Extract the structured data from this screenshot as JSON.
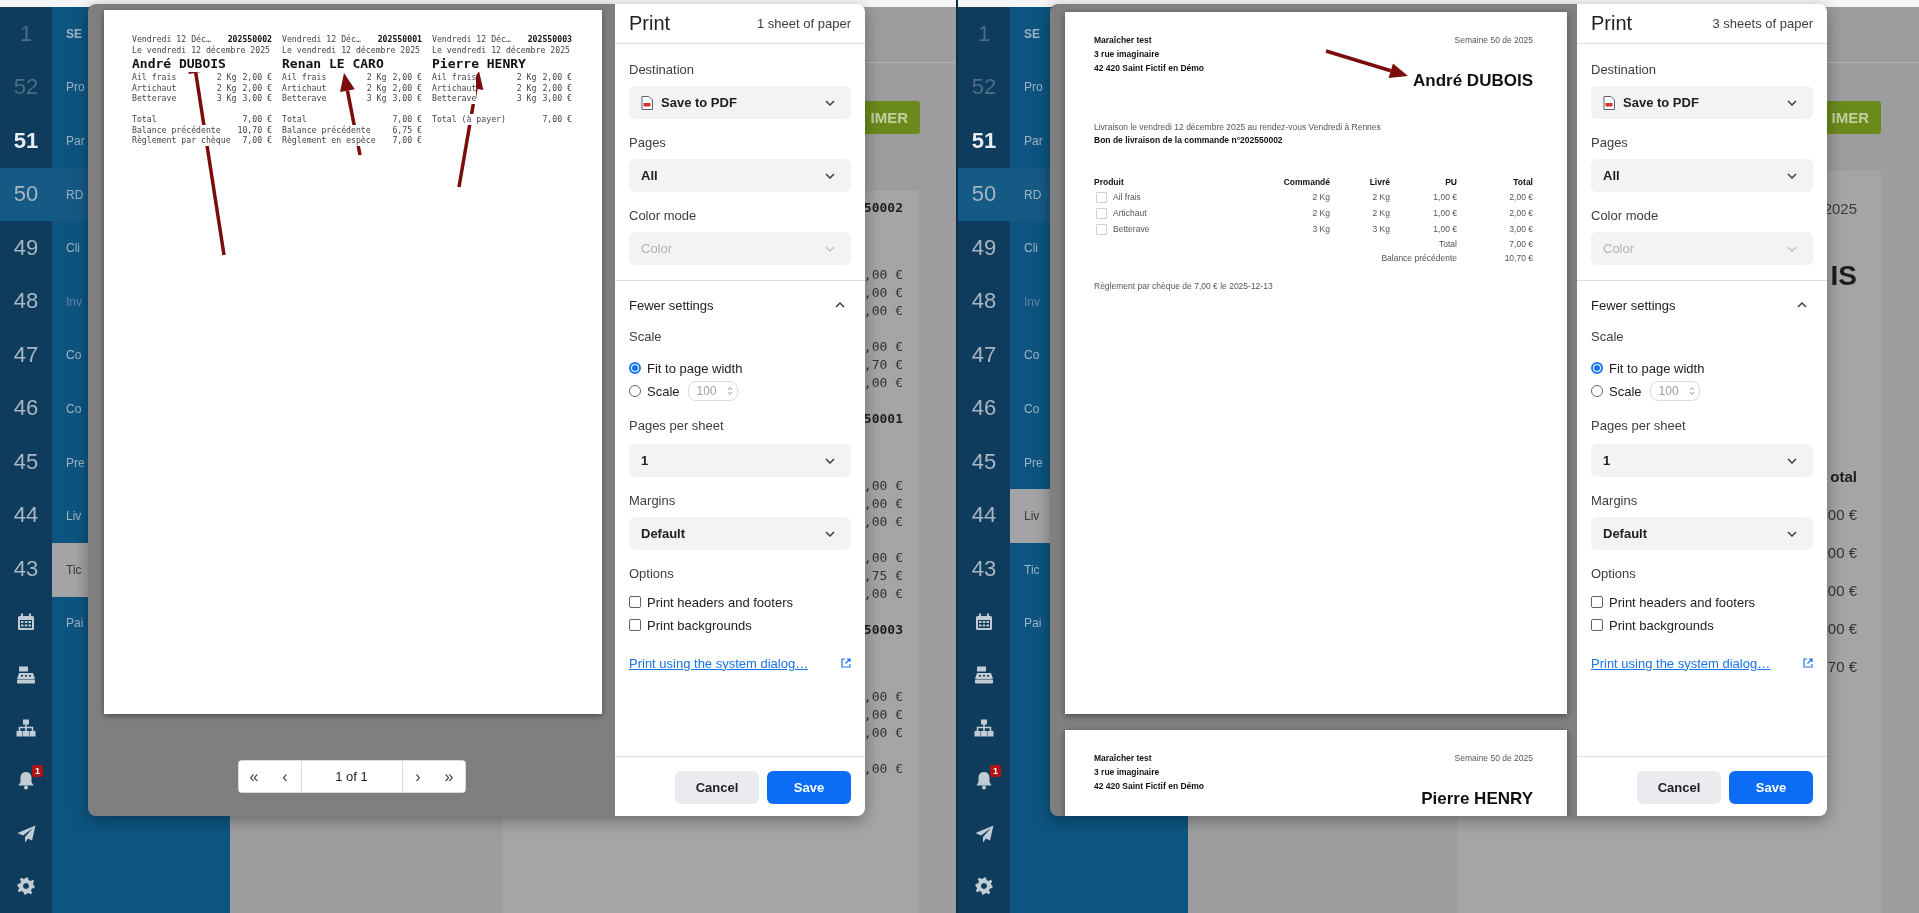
{
  "panels": [
    {
      "weeks": [
        {
          "label": "1",
          "muted": true,
          "selected": false,
          "current": false
        },
        {
          "label": "52",
          "muted": true,
          "selected": false,
          "current": false
        },
        {
          "label": "51",
          "muted": false,
          "selected": true,
          "current": false
        },
        {
          "label": "50",
          "muted": false,
          "selected": false,
          "current": true
        },
        {
          "label": "49",
          "muted": false,
          "selected": false,
          "current": false
        },
        {
          "label": "48",
          "muted": false,
          "selected": false,
          "current": false
        },
        {
          "label": "47",
          "muted": false,
          "selected": false,
          "current": false
        },
        {
          "label": "46",
          "muted": false,
          "selected": false,
          "current": false
        },
        {
          "label": "45",
          "muted": false,
          "selected": false,
          "current": false
        },
        {
          "label": "44",
          "muted": false,
          "selected": false,
          "current": false
        },
        {
          "label": "43",
          "muted": false,
          "selected": false,
          "current": false
        }
      ],
      "notifications": "1",
      "nav": [
        {
          "label": "SE",
          "kind": "header",
          "selected": false,
          "disabled": false
        },
        {
          "label": "Pro",
          "kind": "item",
          "selected": false,
          "disabled": false
        },
        {
          "label": "Par",
          "kind": "item",
          "selected": false,
          "disabled": false
        },
        {
          "label": "RD",
          "kind": "item",
          "selected": false,
          "disabled": false
        },
        {
          "label": "Cli",
          "kind": "item",
          "selected": false,
          "disabled": false
        },
        {
          "label": "Inv",
          "kind": "item",
          "selected": false,
          "disabled": true
        },
        {
          "label": "Co",
          "kind": "item",
          "selected": false,
          "disabled": false
        },
        {
          "label": "Co",
          "kind": "item",
          "selected": false,
          "disabled": false
        },
        {
          "label": "Pre",
          "kind": "item",
          "selected": false,
          "disabled": false
        },
        {
          "label": "Liv",
          "kind": "item",
          "selected": false,
          "disabled": false
        },
        {
          "label": "Tic",
          "kind": "item",
          "selected": true,
          "disabled": false
        },
        {
          "label": "Pai",
          "kind": "item",
          "selected": false,
          "disabled": false
        }
      ],
      "background": {
        "kind": "tickets",
        "button": "IMER",
        "orders": [
          {
            "ref": "50002",
            "items": [
              ",00 €",
              ",00 €",
              ",00 €"
            ],
            "totals": [
              ",00 €",
              ",70 €",
              ",00 €"
            ]
          },
          {
            "ref": "50001",
            "items": [
              ",00 €",
              ",00 €",
              ",00 €"
            ],
            "totals": [
              ",00 €",
              ",75 €",
              ",00 €"
            ]
          },
          {
            "ref": "50003",
            "items": [
              ",00 €",
              ",00 €",
              ",00 €"
            ],
            "totals": [
              ",00 €"
            ]
          }
        ]
      },
      "preview": {
        "kind": "tickets",
        "tickets": [
          {
            "header": "Vendredi 12 Déc…",
            "order": "202550002",
            "date": "Le vendredi 12 décembre 2025",
            "customer": "André DUBOIS",
            "lines": [
              {
                "product": "Ail frais",
                "qty": "2 Kg",
                "amount": "2,00 €"
              },
              {
                "product": "Artichaut",
                "qty": "2 Kg",
                "amount": "2,00 €"
              },
              {
                "product": "Betterave",
                "qty": "3 Kg",
                "amount": "3,00 €"
              }
            ],
            "totals": [
              {
                "label": "Total",
                "amount": "7,00 €"
              },
              {
                "label": "Balance précédente",
                "amount": "10,70 €"
              },
              {
                "label": "Règlement par chèque",
                "amount": "7,00 €"
              }
            ]
          },
          {
            "header": "Vendredi 12 Déc…",
            "order": "202550001",
            "date": "Le vendredi 12 décembre 2025",
            "customer": "Renan LE CARO",
            "lines": [
              {
                "product": "Ail frais",
                "qty": "2 Kg",
                "amount": "2,00 €"
              },
              {
                "product": "Artichaut",
                "qty": "2 Kg",
                "amount": "2,00 €"
              },
              {
                "product": "Betterave",
                "qty": "3 Kg",
                "amount": "3,00 €"
              }
            ],
            "totals": [
              {
                "label": "Total",
                "amount": "7,00 €"
              },
              {
                "label": "Balance précédente",
                "amount": "6,75 €"
              },
              {
                "label": "Règlement en espèce",
                "amount": "7,00 €"
              }
            ]
          },
          {
            "header": "Vendredi 12 Déc…",
            "order": "202550003",
            "date": "Le vendredi 12 décembre 2025",
            "customer": "Pierre HENRY",
            "lines": [
              {
                "product": "Ail frais",
                "qty": "2 Kg",
                "amount": "2,00 €"
              },
              {
                "product": "Artichaut",
                "qty": "2 Kg",
                "amount": "2,00 €"
              },
              {
                "product": "Betterave",
                "qty": "3 Kg",
                "amount": "3,00 €"
              }
            ],
            "totals": [
              {
                "label": "Total (à payer)",
                "amount": "7,00 €"
              }
            ]
          }
        ],
        "pager": {
          "first": "«",
          "prev": "‹",
          "page": "1 of 1",
          "next": "›",
          "last": "»"
        }
      },
      "settings": {
        "title": "Print",
        "sheets": "1 sheet of paper",
        "destination": {
          "label": "Destination",
          "value": "Save to PDF"
        },
        "pages": {
          "label": "Pages",
          "value": "All"
        },
        "color_mode": {
          "label": "Color mode",
          "value": "Color",
          "disabled": true
        },
        "more": {
          "label": "Fewer settings",
          "expanded": true
        },
        "scale": {
          "label": "Scale",
          "options": [
            {
              "label": "Fit to page width",
              "selected": true
            },
            {
              "label": "Scale",
              "selected": false,
              "value": "100"
            }
          ]
        },
        "pages_per_sheet": {
          "label": "Pages per sheet",
          "value": "1"
        },
        "margins": {
          "label": "Margins",
          "value": "Default"
        },
        "options": {
          "label": "Options",
          "items": [
            {
              "label": "Print headers and footers",
              "checked": false
            },
            {
              "label": "Print backgrounds",
              "checked": false
            }
          ]
        },
        "link": "Print using the system dialog…",
        "buttons": [
          {
            "label": "Cancel",
            "kind": "secondary"
          },
          {
            "label": "Save",
            "kind": "primary"
          }
        ]
      }
    },
    {
      "weeks": [
        {
          "label": "1",
          "muted": true,
          "selected": false,
          "current": false
        },
        {
          "label": "52",
          "muted": true,
          "selected": false,
          "current": false
        },
        {
          "label": "51",
          "muted": false,
          "selected": true,
          "current": false
        },
        {
          "label": "50",
          "muted": false,
          "selected": false,
          "current": true
        },
        {
          "label": "49",
          "muted": false,
          "selected": false,
          "current": false
        },
        {
          "label": "48",
          "muted": false,
          "selected": false,
          "current": false
        },
        {
          "label": "47",
          "muted": false,
          "selected": false,
          "current": false
        },
        {
          "label": "46",
          "muted": false,
          "selected": false,
          "current": false
        },
        {
          "label": "45",
          "muted": false,
          "selected": false,
          "current": false
        },
        {
          "label": "44",
          "muted": false,
          "selected": false,
          "current": false
        },
        {
          "label": "43",
          "muted": false,
          "selected": false,
          "current": false
        }
      ],
      "notifications": "1",
      "nav": [
        {
          "label": "SE",
          "kind": "header",
          "selected": false,
          "disabled": false
        },
        {
          "label": "Pro",
          "kind": "item",
          "selected": false,
          "disabled": false
        },
        {
          "label": "Par",
          "kind": "item",
          "selected": false,
          "disabled": false
        },
        {
          "label": "RD",
          "kind": "item",
          "selected": false,
          "disabled": false
        },
        {
          "label": "Cli",
          "kind": "item",
          "selected": false,
          "disabled": false
        },
        {
          "label": "Inv",
          "kind": "item",
          "selected": false,
          "disabled": true
        },
        {
          "label": "Co",
          "kind": "item",
          "selected": false,
          "disabled": false
        },
        {
          "label": "Co",
          "kind": "item",
          "selected": false,
          "disabled": false
        },
        {
          "label": "Pre",
          "kind": "item",
          "selected": false,
          "disabled": false
        },
        {
          "label": "Liv",
          "kind": "item",
          "selected": true,
          "disabled": false
        },
        {
          "label": "Tic",
          "kind": "item",
          "selected": false,
          "disabled": false
        },
        {
          "label": "Pai",
          "kind": "item",
          "selected": false,
          "disabled": false
        }
      ],
      "background": {
        "kind": "delivery",
        "button": "IMER",
        "week": "2025",
        "customer": "IS",
        "total_header": "otal",
        "amounts": [
          "00 €",
          "00 €",
          "00 €",
          "00 €",
          "70 €"
        ]
      },
      "preview": {
        "kind": "delivery",
        "pages": [
          {
            "company": [
              "Maraîcher test",
              "3 rue imaginaire",
              "42 420 Saint Fictif en Démo"
            ],
            "week": "Semaine 50 de 2025",
            "customer": "André DUBOIS",
            "delivery_info": "Livraison le vendredi 12 décembre 2025 au rendez-vous Vendredi à Rennes",
            "order_title": "Bon de livraison de la commande n°202550002",
            "columns": [
              "Produit",
              "Commandé",
              "Livré",
              "PU",
              "Total"
            ],
            "rows": [
              {
                "product": "Ail frais",
                "checked": false,
                "ordered": "2 Kg",
                "delivered": "2 Kg",
                "unit_price": "1,00 €",
                "total": "2,00 €"
              },
              {
                "product": "Artichaut",
                "checked": false,
                "ordered": "2 Kg",
                "delivered": "2 Kg",
                "unit_price": "1,00 €",
                "total": "2,00 €"
              },
              {
                "product": "Betterave",
                "checked": false,
                "ordered": "3 Kg",
                "delivered": "3 Kg",
                "unit_price": "1,00 €",
                "total": "3,00 €"
              }
            ],
            "summary": [
              {
                "label": "Total",
                "value": "7,00 €"
              },
              {
                "label": "Balance précédente",
                "value": "10,70 €"
              }
            ],
            "payment": "Règlement par chèque de 7,00 € le 2025-12-13"
          },
          {
            "company": [
              "Maraîcher test",
              "3 rue imaginaire",
              "42 420 Saint Fictif en Démo"
            ],
            "week": "Semaine 50 de 2025",
            "customer": "Pierre HENRY"
          }
        ]
      },
      "settings": {
        "title": "Print",
        "sheets": "3 sheets of paper",
        "destination": {
          "label": "Destination",
          "value": "Save to PDF"
        },
        "pages": {
          "label": "Pages",
          "value": "All"
        },
        "color_mode": {
          "label": "Color mode",
          "value": "Color",
          "disabled": true
        },
        "more": {
          "label": "Fewer settings",
          "expanded": true
        },
        "scale": {
          "label": "Scale",
          "options": [
            {
              "label": "Fit to page width",
              "selected": true
            },
            {
              "label": "Scale",
              "selected": false,
              "value": "100"
            }
          ]
        },
        "pages_per_sheet": {
          "label": "Pages per sheet",
          "value": "1"
        },
        "margins": {
          "label": "Margins",
          "value": "Default"
        },
        "options": {
          "label": "Options",
          "items": [
            {
              "label": "Print headers and footers",
              "checked": false
            },
            {
              "label": "Print backgrounds",
              "checked": false
            }
          ]
        },
        "link": "Print using the system dialog…",
        "buttons": [
          {
            "label": "Cancel",
            "kind": "secondary"
          },
          {
            "label": "Save",
            "kind": "primary"
          }
        ]
      }
    }
  ]
}
